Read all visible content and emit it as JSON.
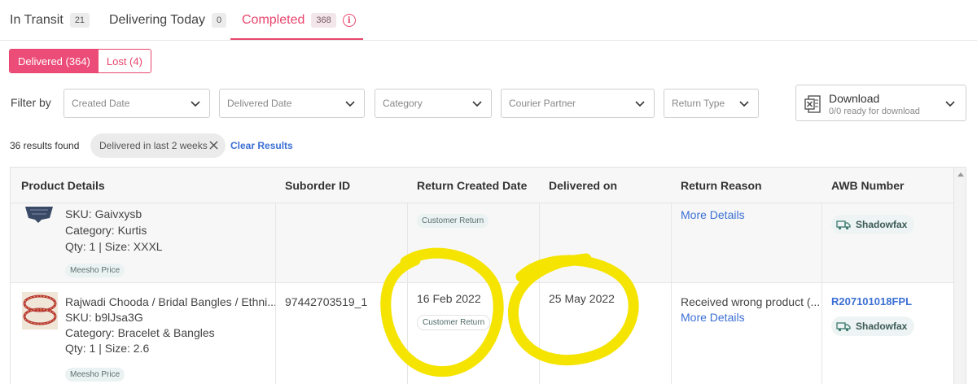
{
  "tabs": [
    {
      "label": "In Transit",
      "count": "21"
    },
    {
      "label": "Delivering Today",
      "count": "0"
    },
    {
      "label": "Completed",
      "count": "368"
    }
  ],
  "subtabs": [
    {
      "label": "Delivered (364)"
    },
    {
      "label": "Lost (4)"
    }
  ],
  "filters": {
    "label": "Filter by",
    "dropdowns": [
      "Created Date",
      "Delivered Date",
      "Category",
      "Courier Partner",
      "Return Type"
    ],
    "download": {
      "title": "Download",
      "subtitle": "0/0 ready for download"
    }
  },
  "results": {
    "count_text": "36 results found",
    "chip": "Delivered in last 2 weeks",
    "clear": "Clear Results"
  },
  "table": {
    "columns": [
      "Product Details",
      "Suborder ID",
      "Return Created Date",
      "Delivered on",
      "Return Reason",
      "AWB Number"
    ],
    "rows": [
      {
        "title": "",
        "sku": "SKU: Gaivxysb",
        "category": "Category: Kurtis",
        "qty": "Qty: 1 | Size: XXXL",
        "price_tag": "Meesho Price",
        "suborder": "",
        "return_created": "",
        "return_tag": "Customer Return",
        "delivered_on": "",
        "reason": "",
        "more": "More Details",
        "awb": "",
        "courier": "Shadowfax"
      },
      {
        "title": "Rajwadi Chooda / Bridal Bangles / Ethni...",
        "sku": "SKU: b9lJsa3G",
        "category": "Category: Bracelet & Bangles",
        "qty": "Qty: 1 | Size: 2.6",
        "price_tag": "Meesho Price",
        "suborder": "97442703519_1",
        "return_created": "16 Feb 2022",
        "return_tag": "Customer Return",
        "delivered_on": "25 May 2022",
        "reason": "Received wrong product (...",
        "more": "More Details",
        "awb": "R207101018FPL",
        "courier": "Shadowfax"
      }
    ]
  },
  "colors": {
    "accent": "#e8456c",
    "link": "#3b6fd4",
    "annotation": "#f5e400"
  },
  "icons": [
    "info-icon",
    "chevron-down-icon",
    "excel-icon",
    "close-icon",
    "truck-icon",
    "scroll-up-icon"
  ]
}
